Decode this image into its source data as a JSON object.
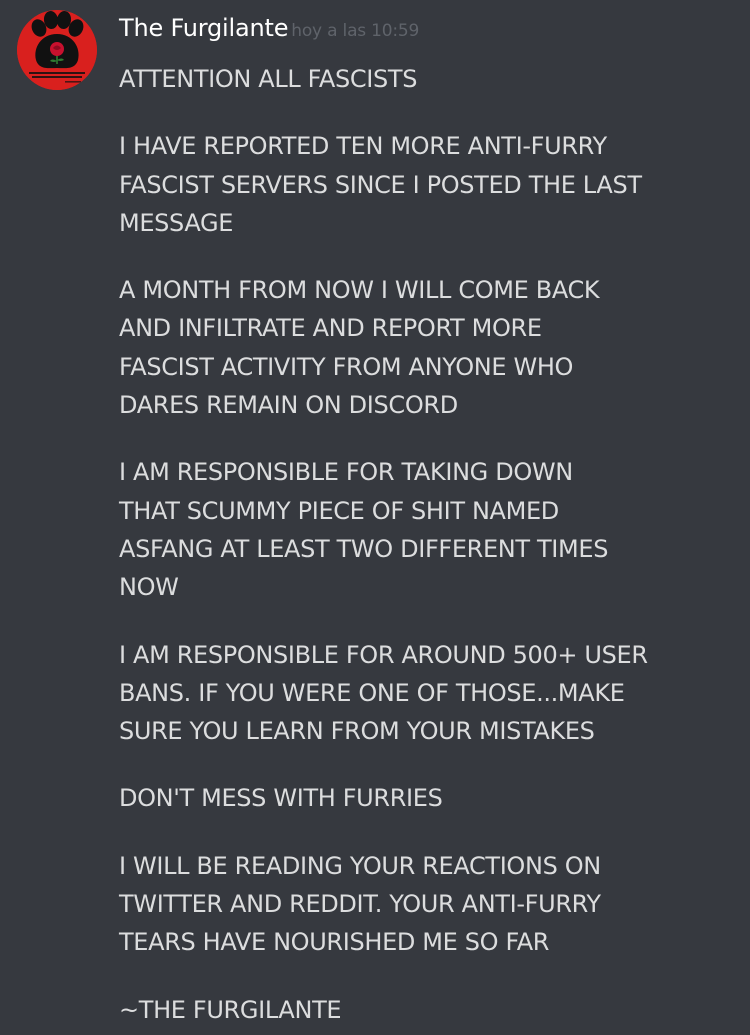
{
  "message": {
    "author": "The Furgilante",
    "timestamp": "hoy a las 10:59",
    "avatar": {
      "icon": "paw-rose-icon",
      "background": "#d9201e",
      "rose_color": "#c8102e",
      "caption_text": "\"Freedom, equality, solidarity and justice for all.\""
    },
    "paragraphs": [
      {
        "lines": [
          "ATTENTION ALL FASCISTS"
        ]
      },
      {
        "lines": [
          "I HAVE REPORTED TEN MORE ANTI-FURRY",
          "FASCIST SERVERS SINCE I POSTED THE LAST",
          "MESSAGE"
        ]
      },
      {
        "lines": [
          "A MONTH FROM NOW I WILL COME BACK",
          "AND INFILTRATE AND REPORT MORE",
          "FASCIST ACTIVITY FROM ANYONE WHO",
          "DARES REMAIN ON DISCORD"
        ]
      },
      {
        "lines": [
          "I AM RESPONSIBLE FOR TAKING DOWN",
          "THAT SCUMMY PIECE OF SHIT NAMED",
          "ASFANG AT LEAST TWO DIFFERENT TIMES",
          "NOW"
        ]
      },
      {
        "lines": [
          "I AM RESPONSIBLE FOR AROUND 500+ USER",
          "BANS. IF YOU WERE ONE OF THOSE...MAKE",
          "SURE YOU LEARN FROM YOUR MISTAKES"
        ]
      },
      {
        "lines": [
          "DON'T MESS WITH FURRIES"
        ]
      },
      {
        "lines": [
          "I WILL BE READING YOUR REACTIONS ON",
          "TWITTER AND REDDIT. YOUR ANTI-FURRY",
          "TEARS HAVE NOURISHED ME SO FAR"
        ]
      },
      {
        "lines": [
          "~THE FURGILANTE"
        ]
      }
    ]
  },
  "colors": {
    "background": "#36393f",
    "username": "#ffffff",
    "timestamp": "#5f636a",
    "message_text": "#dcddde"
  }
}
